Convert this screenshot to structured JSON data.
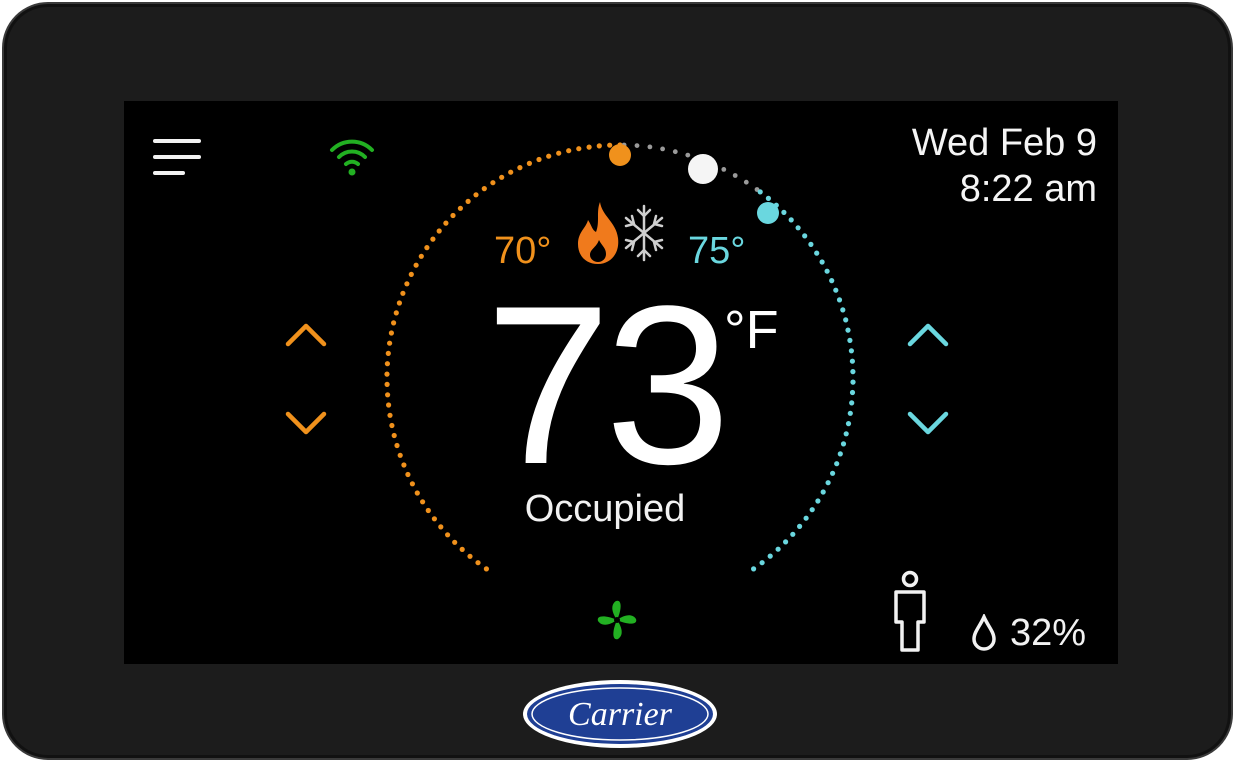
{
  "header": {
    "date": "Wed Feb 9",
    "time": "8:22 am"
  },
  "setpoints": {
    "heat": "70°",
    "cool": "75°"
  },
  "current": {
    "temperature": "73",
    "unit": "°F",
    "status": "Occupied"
  },
  "humidity": "32%",
  "brand": "Carrier",
  "colors": {
    "heat": "#f0911c",
    "cool": "#6ad7df",
    "wifi": "#22b022",
    "fan": "#22b022",
    "brand_blue": "#1f3f94"
  },
  "icons": [
    "menu-icon",
    "wifi-icon",
    "flame-icon",
    "snowflake-icon",
    "fan-icon",
    "person-icon",
    "droplet-icon"
  ]
}
